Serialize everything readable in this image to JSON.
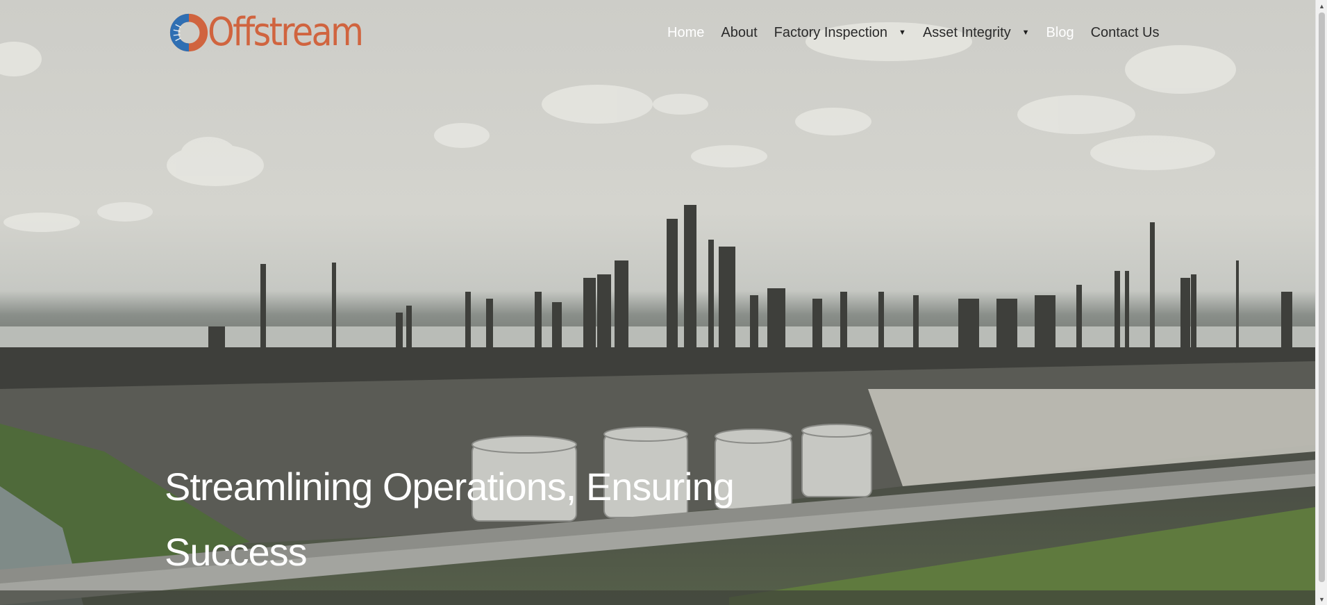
{
  "brand": {
    "name": "Offstream",
    "accent": "#d0643f",
    "ring_color": "#2f6fb3"
  },
  "nav": {
    "items": [
      {
        "label": "Home",
        "state": "active",
        "has_dropdown": false
      },
      {
        "label": "About",
        "state": "normal",
        "has_dropdown": false
      },
      {
        "label": "Factory Inspection",
        "state": "normal",
        "has_dropdown": true
      },
      {
        "label": "Asset Integrity",
        "state": "normal",
        "has_dropdown": true
      },
      {
        "label": "Blog",
        "state": "highlight",
        "has_dropdown": false
      },
      {
        "label": "Contact Us",
        "state": "normal",
        "has_dropdown": false
      }
    ],
    "dropdown_icon": "caret-down-icon"
  },
  "hero": {
    "background": "aerial view of an oil refinery under a cloudy sky",
    "headline_line1": "Streamlining Operations, Ensuring",
    "headline_line2": "Success"
  },
  "scrollbar": {
    "up_icon": "arrow-up-icon",
    "down_icon": "arrow-down-icon"
  }
}
